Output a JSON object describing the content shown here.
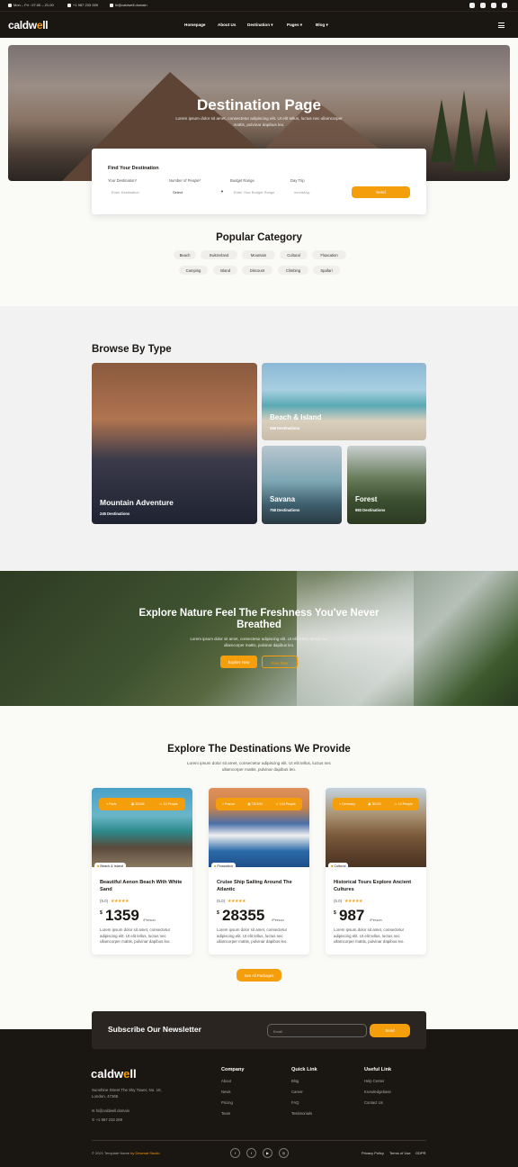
{
  "topbar": {
    "hours": "Mon – Fri : 07.00 – 21.00",
    "phone": "+1 987 233 289",
    "email": "hi@caldwell.domain"
  },
  "nav": {
    "logo_main": "caldw",
    "logo_accent": "e",
    "logo_tail": "ll",
    "items": [
      "Homepage",
      "About Us",
      "Destination ▾",
      "Pages ▾",
      "Blog ▾"
    ]
  },
  "hero": {
    "title": "Destination Page",
    "description": "Lorem ipsum dolor sit amet, consectetur adipiscing elit. Ut elit tellus, luctus nec ullamcorper mattis, pulvinar dapibus leo."
  },
  "search": {
    "title": "Find Your Destination",
    "labels": [
      "Your Destination*",
      "Number of People*",
      "Budget Range",
      "Day Trip"
    ],
    "destination_placeholder": "Enter Destination",
    "people_value": "Select",
    "budget_placeholder": "Enter Your Budget Range",
    "date_placeholder": "mm/dd/yy",
    "button": "Send"
  },
  "popular": {
    "title": "Popular Category",
    "row1": [
      "Beach",
      "Switzerland",
      "Mountain",
      "Cultural",
      "Floacation"
    ],
    "row2": [
      "Camping",
      "Island",
      "Discount",
      "Climbing",
      "Spafari"
    ]
  },
  "browse": {
    "title": "Browse By Type",
    "cards": [
      {
        "name": "Mountain Adventure",
        "count": "245 Destinations"
      },
      {
        "name": "Beach & Island",
        "count": "466 Destinations"
      },
      {
        "name": "Savana",
        "count": "758 Destinations"
      },
      {
        "name": "Forest",
        "count": "983 Destinations"
      }
    ]
  },
  "nature": {
    "title": "Explore Nature Feel The Freshness You've Never Breathed",
    "description": "Lorem ipsum dolor sit amet, consectetur adipiscing elit. Ut elit tellus, luctus nec ullamcorper mattis, pulvinar dapibus leo.",
    "btn_primary": "Explore Now",
    "btn_secondary": "Free Now"
  },
  "destinations": {
    "title": "Explore The Destinations We Provide",
    "description": "Lorem ipsum dolor sit amet, consectetur adipiscing elit. Ut elit tellus, luctus nec ullamcorper mattis, pulvinar dapibus leo.",
    "see_all": "See All Packages",
    "packages": [
      {
        "place": "Paris",
        "days": "3D/2N",
        "people": "10 People",
        "tag": "Beach & Island",
        "title": "Beautiful Aenon Beach With White Sand",
        "rating": "(5.0)",
        "currency": "$",
        "price": "1359",
        "per": "/Person",
        "desc": "Lorem ipsum dolor sit amet, consectetur adipiscing elit. Ut elit tellus, luctus nec ullamcorper mattis, pulvinar dapibus leo."
      },
      {
        "place": "France",
        "days": "7D/10N",
        "people": "104 People",
        "tag": "Floacation",
        "title": "Cruise Ship Sailing Around The Atlantic",
        "rating": "(5.0)",
        "currency": "$",
        "price": "28355",
        "per": "/Person",
        "desc": "Lorem ipsum dolor sit amet, consectetur adipiscing elit. Ut elit tellus, luctus nec ullamcorper mattis, pulvinar dapibus leo."
      },
      {
        "place": "Germany",
        "days": "3D/2N",
        "people": "15 People",
        "tag": "Cultural",
        "title": "Historical Tours Explore Ancient Cultures",
        "rating": "(5.0)",
        "currency": "$",
        "price": "987",
        "per": "/Person",
        "desc": "Lorem ipsum dolor sit amet, consectetur adipiscing elit. Ut elit tellus, luctus nec ullamcorper mattis, pulvinar dapibus leo."
      }
    ]
  },
  "newsletter": {
    "title": "Subscribe Our Newsletter",
    "placeholder": "Email",
    "button": "Send"
  },
  "footer": {
    "logo_main": "caldw",
    "logo_accent": "e",
    "logo_tail": "ll",
    "address": "Sunshine Street The Sky Tower, No. 10, London, 47365",
    "email": "hi@caldwell.domain",
    "phone": "+1 987 233 289",
    "columns": [
      {
        "title": "Company",
        "links": [
          "About",
          "News",
          "Pricing",
          "Team"
        ]
      },
      {
        "title": "Quick Link",
        "links": [
          "Blog",
          "Career",
          "FAQ",
          "Testimonials"
        ]
      },
      {
        "title": "Useful Link",
        "links": [
          "Help Center",
          "Knowledgebase",
          "Contact Us"
        ]
      }
    ],
    "copyright": "© 2021 Template Name",
    "credit": "by Dewmat Studio",
    "legal": [
      "Privacy Policy",
      "Terms of Use",
      "GDPR"
    ]
  },
  "colors": {
    "accent": "#f59e0b",
    "dark": "#1a1612"
  },
  "icons": [
    "clock-icon",
    "phone-icon",
    "mail-icon",
    "facebook-icon",
    "linkedin-icon",
    "instagram-icon",
    "youtube-icon",
    "hamburger-icon",
    "star-icon",
    "location-icon",
    "calendar-icon",
    "people-icon",
    "twitter-icon"
  ]
}
